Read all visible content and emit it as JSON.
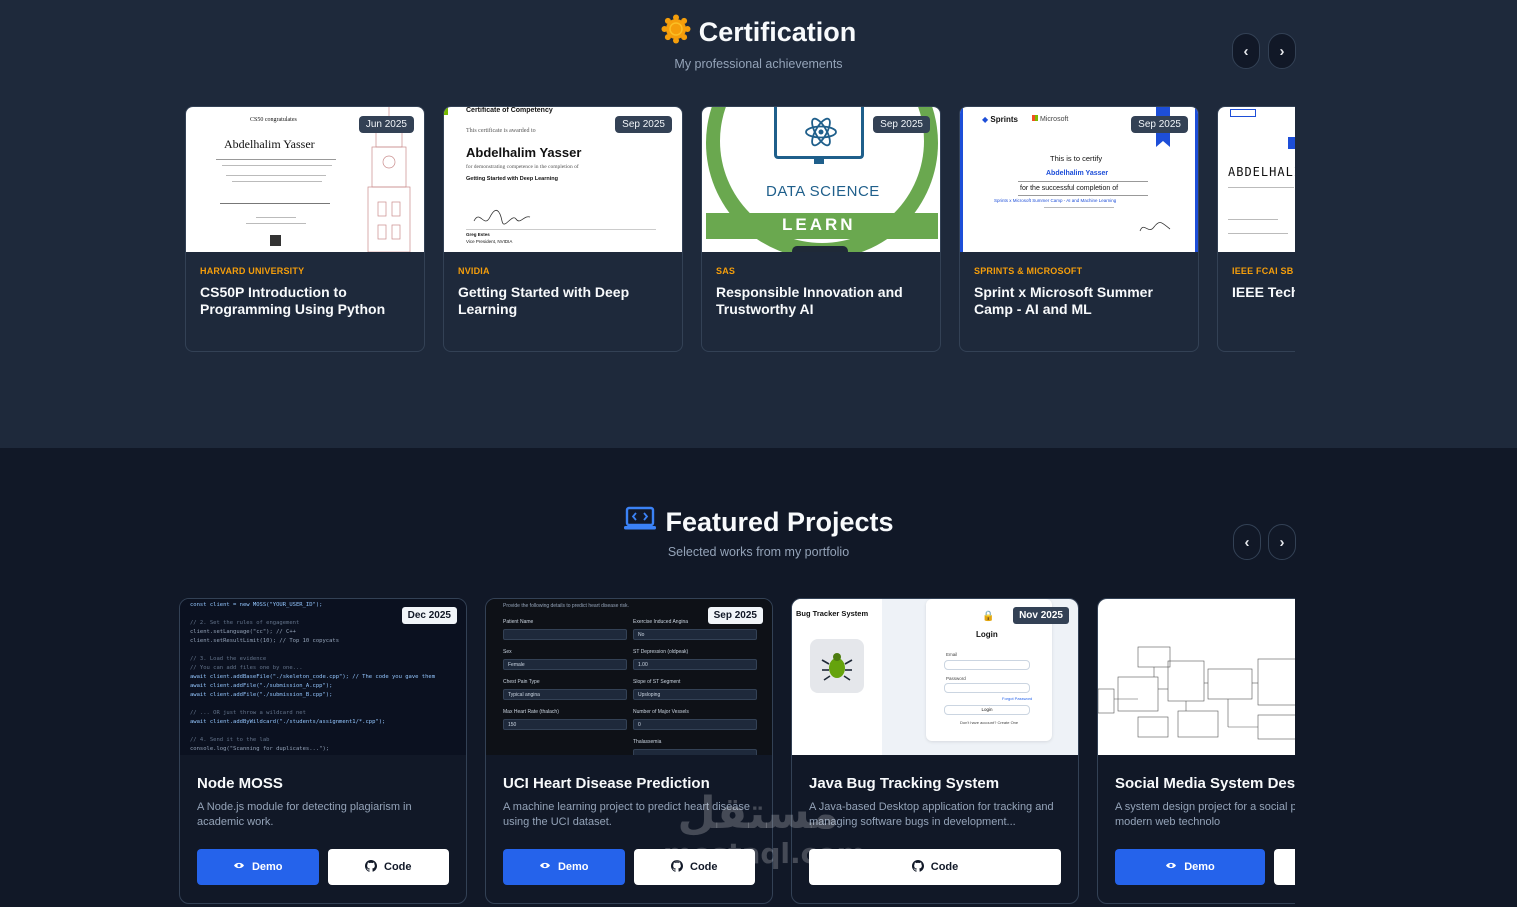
{
  "certification": {
    "title": "Certification",
    "subtitle": "My professional achievements",
    "prev_label": "‹",
    "next_label": "›",
    "cards": [
      {
        "date": "Jun 2025",
        "issuer": "HARVARD UNIVERSITY",
        "name": "CS50P Introduction to Programming Using Python",
        "thumb": {
          "heading": "CS50 congratulates",
          "recipient": "Abdelhalim Yasser"
        }
      },
      {
        "date": "Sep 2025",
        "issuer": "NVIDIA",
        "name": "Getting Started with Deep Learning",
        "thumb": {
          "heading": "Certificate of Competency",
          "line1": "This certificate is awarded to",
          "recipient": "Abdelhalim Yasser",
          "line2": "for demonstrating competence in the completion of",
          "course": "Getting Started with Deep Learning",
          "signer": "Greg Estes",
          "signer_title": "Vice President, NVIDIA"
        }
      },
      {
        "date": "Sep 2025",
        "issuer": "SAS",
        "name": "Responsible Innovation and Trustworthy AI",
        "thumb": {
          "label": "DATA SCIENCE",
          "band": "LEARN"
        }
      },
      {
        "date": "Sep 2025",
        "issuer": "SPRINTS & MICROSOFT",
        "name": "Sprint x Microsoft Summer Camp - AI and ML",
        "thumb": {
          "brand1": "Sprints",
          "brand2": "Microsoft",
          "line1": "This is to certify",
          "recipient": "Abdelhalim Yasser",
          "line2": "for the successful completion of",
          "course": "Sprints x Microsoft Summer Camp - AI and Machine Learning"
        }
      },
      {
        "date": "",
        "issuer": "IEEE FCAI SB",
        "name": "IEEE Tech Machine L",
        "thumb": {
          "recipient": "ABDELHALIM"
        }
      }
    ]
  },
  "projects": {
    "title": "Featured Projects",
    "subtitle": "Selected works from my portfolio",
    "prev_label": "‹",
    "next_label": "›",
    "cards": [
      {
        "date": "Dec 2025",
        "name": "Node MOSS",
        "description": "A Node.js module for detecting plagiarism in academic work.",
        "demo_label": "Demo",
        "code_label": "Code",
        "thumb": {
          "code_lines": [
            "const client = new MOSS(\"YOUR_USER_ID\");",
            "",
            "// 2. Set the rules of engagement",
            "client.setLanguage(\"cc\"); // C++",
            "client.setResultLimit(10); // Top 10 copycats",
            "",
            "// 3. Load the evidence",
            "// You can add files one by one...",
            "await client.addBaseFile(\"./skeleton_code.cpp\"); // The code you gave them",
            "await client.addFile(\"./submission_A.cpp\");",
            "await client.addFile(\"./submission_B.cpp\");",
            "",
            "// ... OR just throw a wildcard net",
            "await client.addByWildcard(\"./students/assignment1/*.cpp\");",
            "",
            "// 4. Send it to the lab",
            "console.log(\"Scanning for duplicates...\");"
          ]
        }
      },
      {
        "date": "Sep 2025",
        "name": "UCI Heart Disease Prediction",
        "description": "A machine learning project to predict heart disease using the UCI dataset.",
        "demo_label": "Demo",
        "code_label": "Code",
        "thumb": {
          "intro": "Provide the following details to predict heart disease risk.",
          "fields": [
            {
              "label": "Patient Name",
              "value": ""
            },
            {
              "label": "Exercise Induced Angina",
              "value": "No"
            },
            {
              "label": "Sex",
              "value": "Female"
            },
            {
              "label": "ST Depression (oldpeak)",
              "value": "1.00"
            },
            {
              "label": "Chest Pain Type",
              "value": "Typical angina"
            },
            {
              "label": "Slope of ST Segment",
              "value": "Upsloping"
            },
            {
              "label": "Max Heart Rate (thalach)",
              "value": "150"
            },
            {
              "label": "Number of Major Vessels",
              "value": "0"
            },
            {
              "label": "Thalassemia",
              "value": ""
            }
          ]
        }
      },
      {
        "date": "Nov 2025",
        "name": "Java Bug Tracking System",
        "description": "A Java-based Desktop application for tracking and managing software bugs in development...",
        "demo_label": "",
        "code_label": "Code",
        "thumb": {
          "app_title": "Bug Tracker System",
          "login_title": "Login",
          "email_label": "Email",
          "password_label": "Password",
          "forgot": "Forgot Password",
          "login_btn": "Login",
          "signup": "Don't have account? Create One"
        }
      },
      {
        "date": "",
        "name": "Social Media System Des",
        "description": "A system design project for a social platform using modern web technolo",
        "demo_label": "Demo",
        "code_label": "",
        "thumb": {}
      }
    ]
  },
  "watermark": {
    "arabic": "مستقل",
    "latin": "mostaql.com"
  }
}
